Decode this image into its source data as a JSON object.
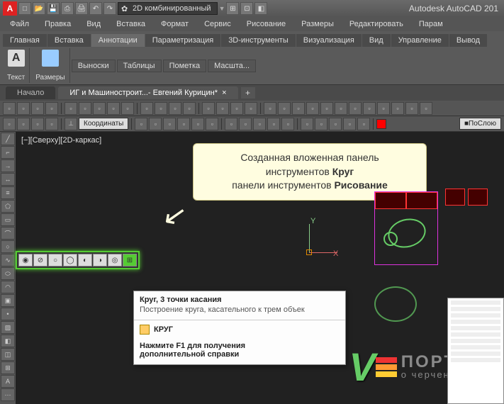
{
  "app": {
    "title": "Autodesk AutoCAD 201"
  },
  "workspace_selector": "2D комбинированный",
  "menu": [
    "Файл",
    "Правка",
    "Вид",
    "Вставка",
    "Формат",
    "Сервис",
    "Рисование",
    "Размеры",
    "Редактировать",
    "Парам"
  ],
  "ribbon_tabs": [
    "Главная",
    "Вставка",
    "Аннотации",
    "Параметризация",
    "3D-инструменты",
    "Визуализация",
    "Вид",
    "Управление",
    "Вывод"
  ],
  "ribbon_active": 2,
  "ribbon_panels": {
    "text": "Текст",
    "dims": "Размеры",
    "btns": [
      "Выноски",
      "Таблицы",
      "Пометка",
      "Масшта..."
    ]
  },
  "doc_tabs": {
    "start": "Начало",
    "active": "ИГ и Машиностроит...- Евгений Курицин*"
  },
  "coords_label": "Координаты",
  "layer_combo": "ПоСлою",
  "viewport_label": "[−][Сверху][2D-каркас]",
  "callout": {
    "l1": "Созданная вложенная панель",
    "l2a": "инструментов ",
    "l2b": "Круг",
    "l3a": "панели инструментов ",
    "l3b": "Рисование"
  },
  "ucs": {
    "x": "X",
    "y": "Y"
  },
  "tooltip": {
    "title": "Круг, 3 точки касания",
    "desc": "Построение круга, касательного к трем объек",
    "cmd": "КРУГ",
    "f1a": "Нажмите F1 для получения",
    "f1b": "дополнительной справки"
  },
  "logo": {
    "l1": "ПОРТАЛ",
    "l2": "о черчении"
  }
}
